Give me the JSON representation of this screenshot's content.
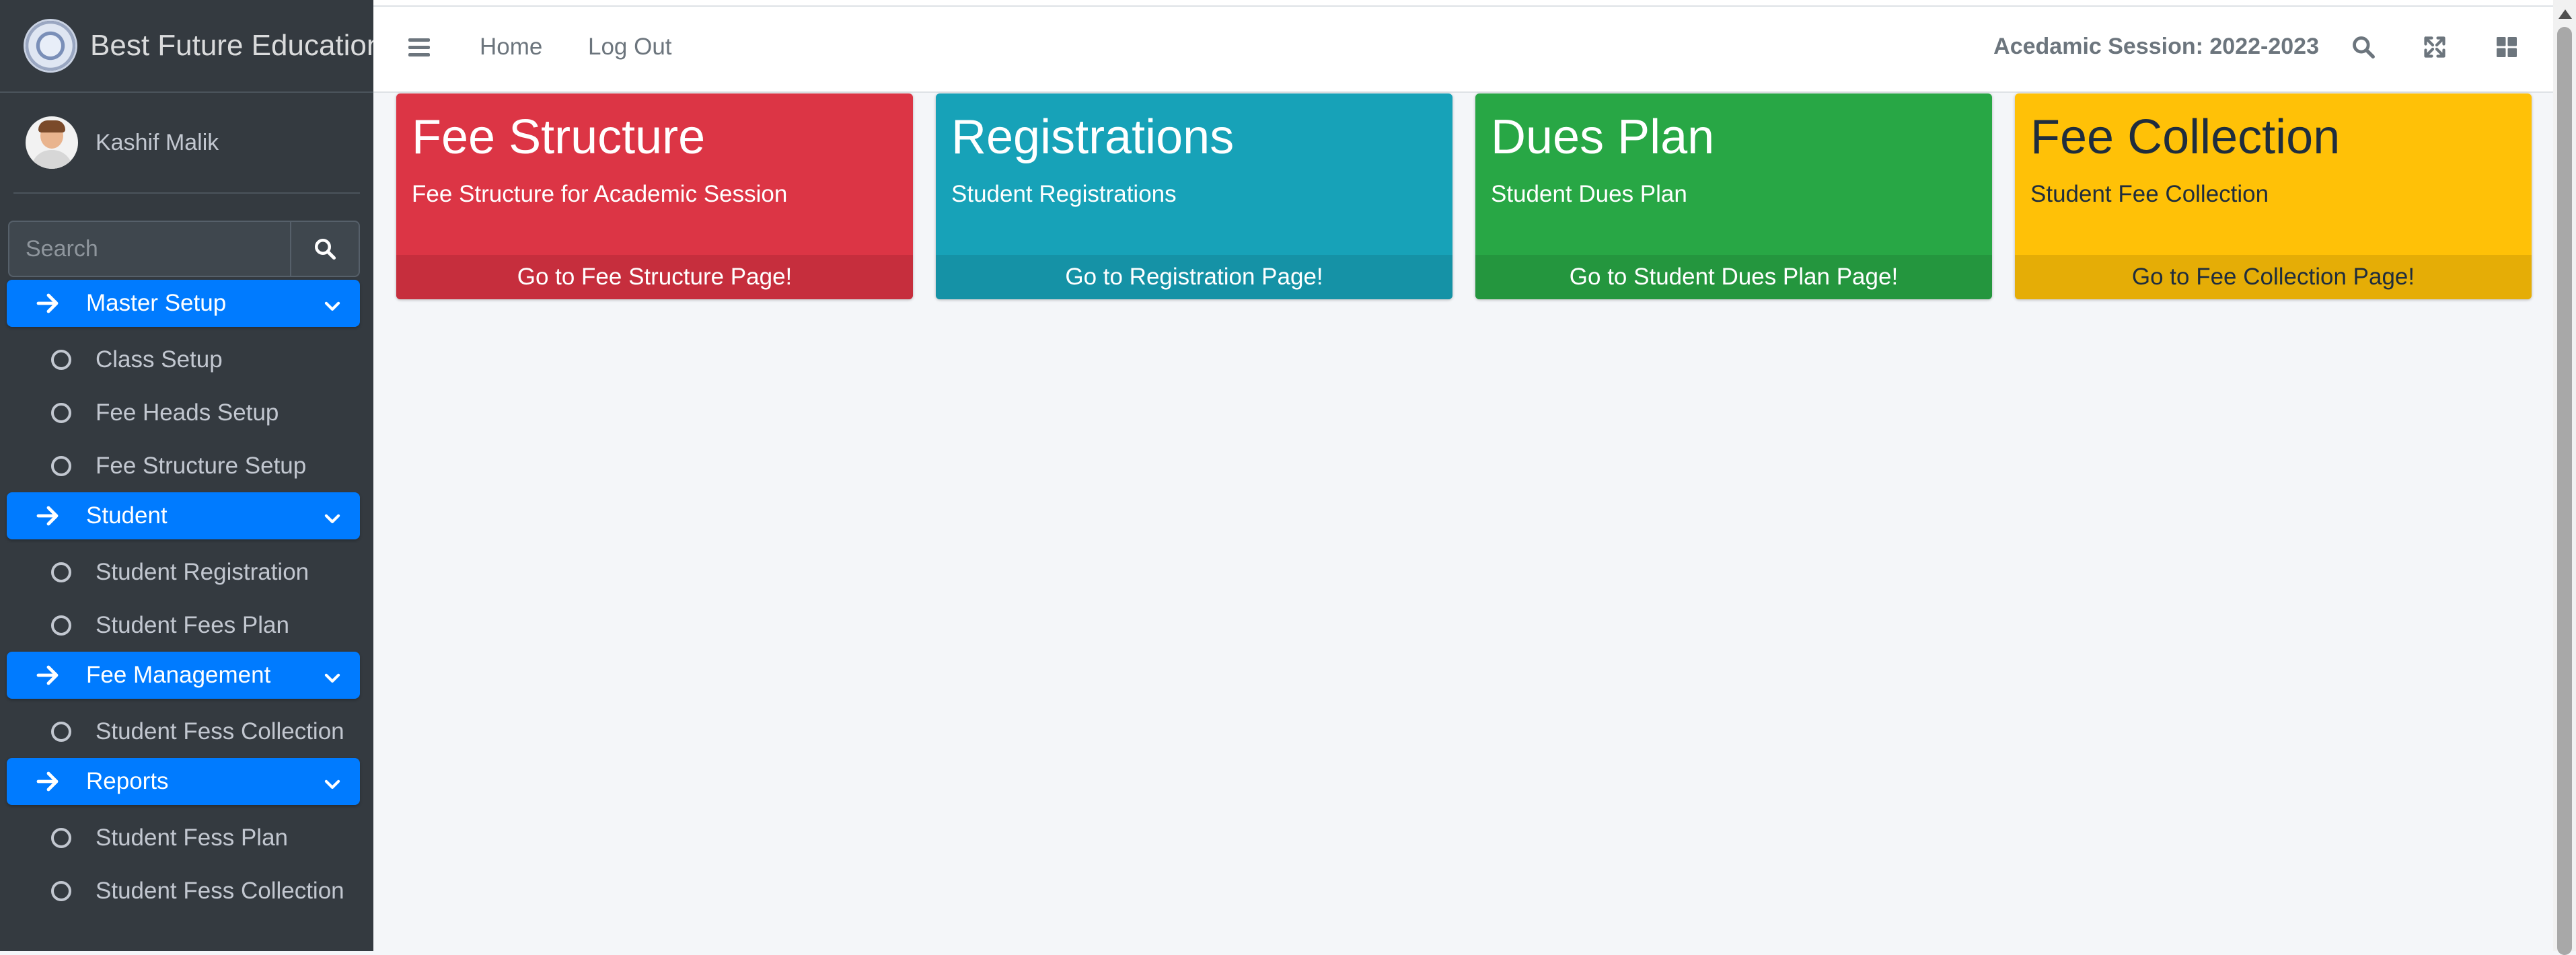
{
  "brand": {
    "name": "Best Future Education S"
  },
  "user": {
    "name": "Kashif Malik"
  },
  "search": {
    "placeholder": "Search"
  },
  "sidebar": {
    "groups": [
      {
        "label": "Master Setup",
        "items": [
          {
            "label": "Class Setup"
          },
          {
            "label": "Fee Heads Setup"
          },
          {
            "label": "Fee Structure Setup"
          }
        ]
      },
      {
        "label": "Student",
        "items": [
          {
            "label": "Student Registration"
          },
          {
            "label": "Student Fees Plan"
          }
        ]
      },
      {
        "label": "Fee Management",
        "items": [
          {
            "label": "Student Fess Collection"
          }
        ]
      },
      {
        "label": "Reports",
        "items": [
          {
            "label": "Student Fess Plan"
          },
          {
            "label": "Student Fess Collection"
          }
        ]
      }
    ]
  },
  "navbar": {
    "home": "Home",
    "logout": "Log Out",
    "session": "Acedamic Session: 2022-2023"
  },
  "cards": [
    {
      "title": "Fee Structure",
      "subtitle": "Fee Structure for Academic Session",
      "link": "Go to Fee Structure Page!"
    },
    {
      "title": "Registrations",
      "subtitle": "Student Registrations",
      "link": "Go to Registration Page!"
    },
    {
      "title": "Dues Plan",
      "subtitle": "Student Dues Plan",
      "link": "Go to Student Dues Plan Page!"
    },
    {
      "title": "Fee Collection",
      "subtitle": "Student Fee Collection",
      "link": "Go to Fee Collection Page!"
    }
  ],
  "colors": {
    "sidebar_bg": "#343a40",
    "nav_active": "#007bff",
    "card_red": "#dc3545",
    "card_teal": "#17a2b8",
    "card_green": "#28a745",
    "card_yellow": "#ffc107"
  }
}
